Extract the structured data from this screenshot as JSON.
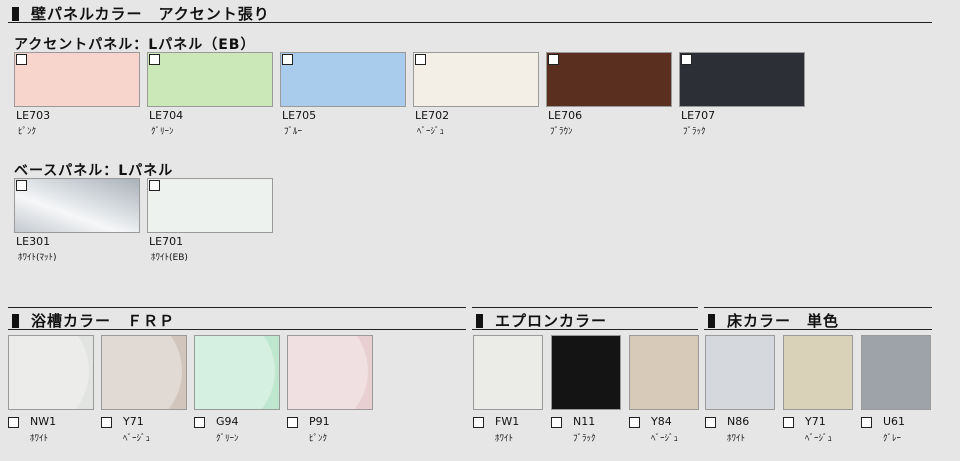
{
  "wall": {
    "title": "壁パネルカラー　アクセント張り",
    "accent_label": "アクセントパネル：Lパネル（EB）",
    "accent": [
      {
        "code": "LE703",
        "name": "ﾋﾟﾝｸ",
        "color": "#f7d4cc"
      },
      {
        "code": "LE704",
        "name": "ｸﾞﾘｰﾝ",
        "color": "#cbe8b8"
      },
      {
        "code": "LE705",
        "name": "ﾌﾞﾙｰ",
        "color": "#a9ccec"
      },
      {
        "code": "LE702",
        "name": "ﾍﾞｰｼﾞｭ",
        "color": "#f4efe6"
      },
      {
        "code": "LE706",
        "name": "ﾌﾞﾗｳﾝ",
        "color": "#5a2f1f"
      },
      {
        "code": "LE707",
        "name": "ﾌﾞﾗｯｸ",
        "color": "#2d2f36"
      }
    ],
    "base_label": "ベースパネル：Lパネル",
    "base": [
      {
        "code": "LE301",
        "name": "ﾎﾜｲﾄ(ﾏｯﾄ)",
        "color": "#c9d0d6"
      },
      {
        "code": "LE701",
        "name": "ﾎﾜｲﾄ(EB)",
        "color": "#eef2ef"
      }
    ]
  },
  "tub": {
    "title": "浴槽カラー　ＦＲＰ",
    "items": [
      {
        "code": "NW1",
        "name": "ﾎﾜｲﾄ",
        "color": "#e2e4e1"
      },
      {
        "code": "Y71",
        "name": "ﾍﾞｰｼﾞｭ",
        "color": "#d2c5bc"
      },
      {
        "code": "G94",
        "name": "ｸﾞﾘｰﾝ",
        "color": "#bfe6cf"
      },
      {
        "code": "P91",
        "name": "ﾋﾟﾝｸ",
        "color": "#e8cfd2"
      }
    ]
  },
  "apron": {
    "title": "エプロンカラー",
    "items": [
      {
        "code": "FW1",
        "name": "ﾎﾜｲﾄ",
        "color": "#ebebe7"
      },
      {
        "code": "N11",
        "name": "ﾌﾞﾗｯｸ",
        "color": "#141414"
      },
      {
        "code": "Y84",
        "name": "ﾍﾞｰｼﾞｭ",
        "color": "#d7cab8"
      }
    ]
  },
  "floor": {
    "title": "床カラー　単色",
    "items": [
      {
        "code": "N86",
        "name": "ﾎﾜｲﾄ",
        "color": "#d5d9de"
      },
      {
        "code": "Y71",
        "name": "ﾍﾞｰｼﾞｭ",
        "color": "#d9d1b8"
      },
      {
        "code": "U61",
        "name": "ｸﾞﾚｰ",
        "color": "#9ea3aa"
      }
    ]
  }
}
